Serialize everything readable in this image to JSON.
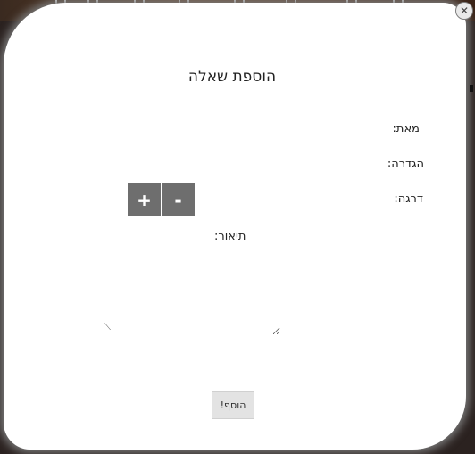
{
  "dialog": {
    "title": "הוספת שאלה",
    "close_icon": "close-icon",
    "labels": {
      "from": "מאת:",
      "definition": "הגדרה:",
      "difficulty": "דרגה:",
      "description": "תיאור:"
    },
    "stepper": {
      "plus_label": "+",
      "minus_label": "-"
    },
    "submit_label": "הוסף!"
  }
}
